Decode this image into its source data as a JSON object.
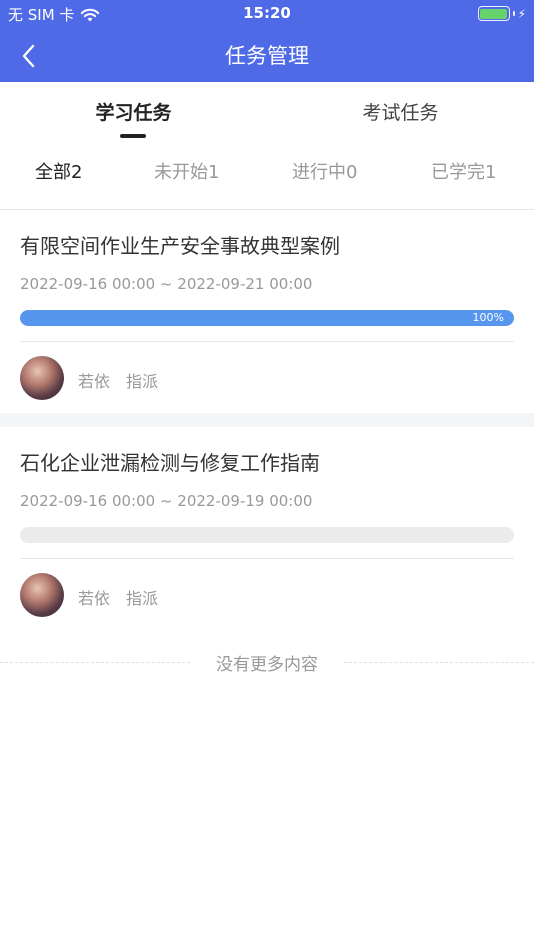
{
  "status_bar": {
    "carrier": "无 SIM 卡",
    "time": "15:20",
    "wifi_icon": "wifi-icon",
    "battery_icon": "battery-icon",
    "charging_icon": "bolt-icon",
    "battery_level": 1.0
  },
  "nav": {
    "title": "任务管理",
    "back_icon": "chevron-left-icon"
  },
  "main_tabs": [
    {
      "label": "学习任务",
      "active": true
    },
    {
      "label": "考试任务",
      "active": false
    }
  ],
  "filter_tabs": [
    {
      "label": "全部2",
      "active": true
    },
    {
      "label": "未开始1",
      "active": false
    },
    {
      "label": "进行中0",
      "active": false
    },
    {
      "label": "已学完1",
      "active": false
    }
  ],
  "tasks": [
    {
      "title": "有限空间作业生产安全事故典型案例",
      "date_range": "2022-09-16 00:00 ~ 2022-09-21 00:00",
      "progress": 100,
      "progress_label": "100%",
      "author": "若依",
      "type": "指派"
    },
    {
      "title": "石化企业泄漏检测与修复工作指南",
      "date_range": "2022-09-16 00:00 ~ 2022-09-19 00:00",
      "progress": 0,
      "progress_label": "",
      "author": "若依",
      "type": "指派"
    }
  ],
  "footer": {
    "end_text": "没有更多内容"
  },
  "colors": {
    "header": "#4F6AE6",
    "progress": "#5696EE",
    "battery": "#67D16A"
  }
}
